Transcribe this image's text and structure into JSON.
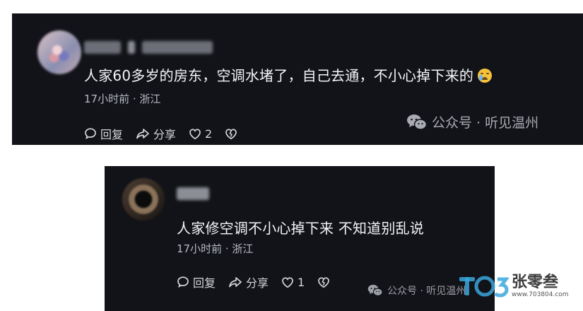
{
  "comments": [
    {
      "text": "人家60多岁的房东，空调水堵了，自己去通，不小心掉下来的",
      "emoji": "crying-face-emoji",
      "meta": "17小时前 · 浙江",
      "reply_label": "回复",
      "share_label": "分享",
      "like_count": "2",
      "watermark": "公众号 · 听见温州"
    },
    {
      "text": "人家修空调不小心掉下来 不知道别乱说",
      "meta": "17小时前 · 浙江",
      "reply_label": "回复",
      "share_label": "分享",
      "like_count": "1",
      "watermark": "公众号 · 听见温州"
    }
  ],
  "site_logo": {
    "name": "张零叁",
    "url": "www.703804.com",
    "mark_color": "#3aa7dc"
  },
  "colors": {
    "card_bg": "#121318",
    "text": "#f4f5f8",
    "meta": "#b7bac3"
  }
}
